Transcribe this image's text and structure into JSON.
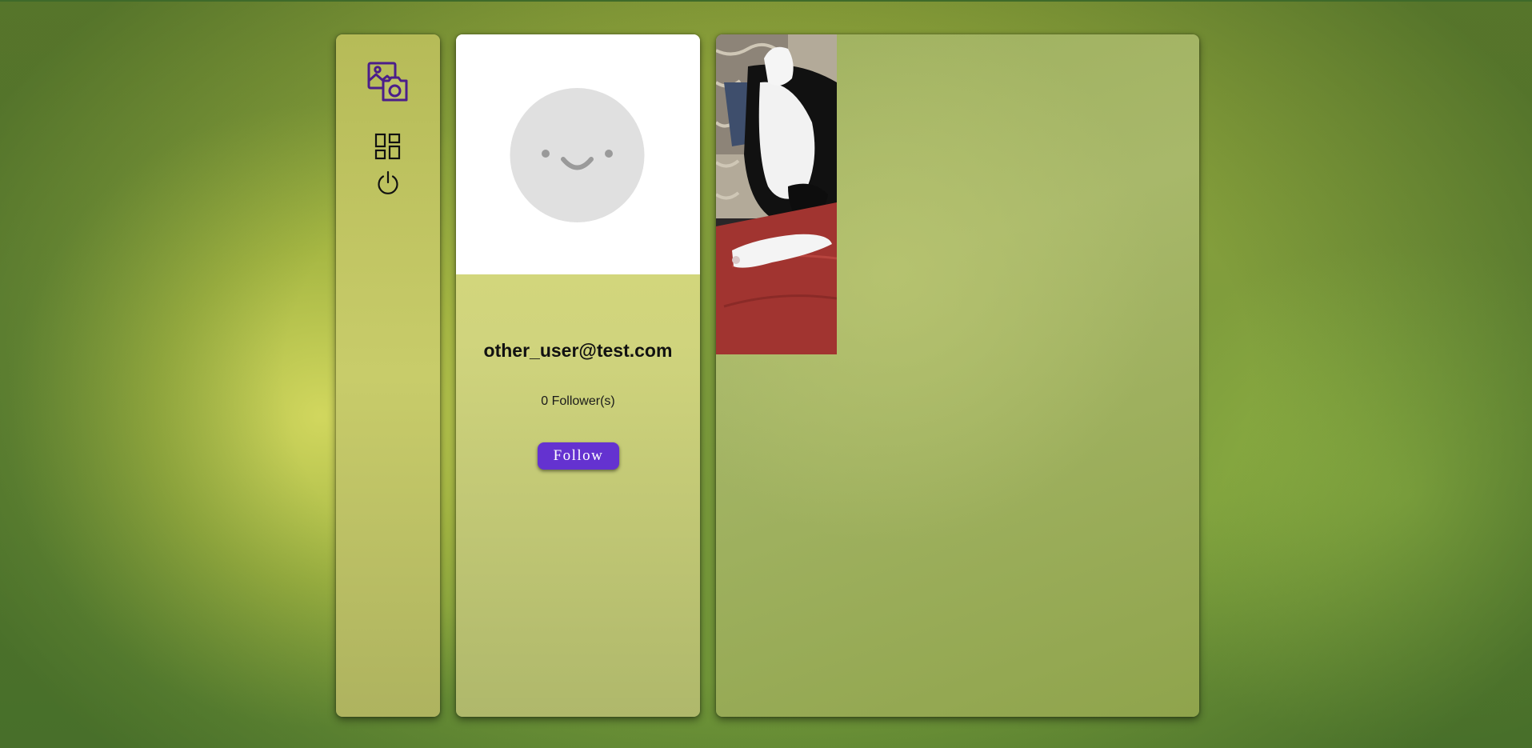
{
  "profile": {
    "username": "other_user@test.com",
    "followers_text": "0 Follower(s)",
    "follow_label": "Follow"
  },
  "sidebar": {
    "icons": [
      "photos-camera-logo-icon",
      "dashboard-icon",
      "power-icon"
    ]
  },
  "gallery": {
    "photos": [
      {
        "subject": "cat-photo"
      }
    ]
  },
  "colors": {
    "accent": "#6432d0",
    "logo_stroke": "#4b1e8a",
    "panel_bg": "#c8cc6a",
    "avatar_bg": "#e0e0e0"
  }
}
